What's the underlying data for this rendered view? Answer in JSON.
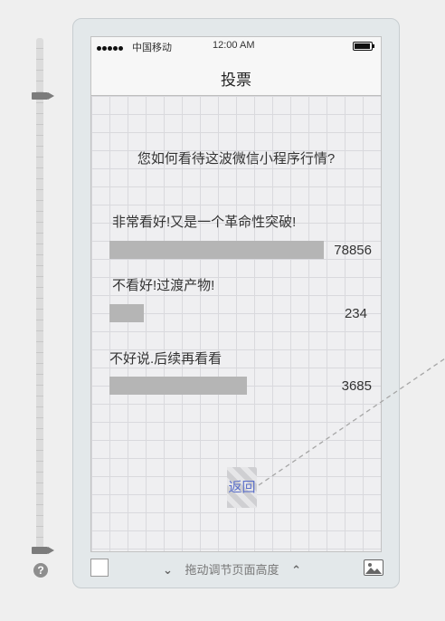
{
  "status_bar": {
    "carrier": "中国移动",
    "time": "12:00 AM"
  },
  "nav": {
    "title": "投票"
  },
  "poll": {
    "question": "您如何看待这波微信小程序行情?",
    "options": [
      {
        "label": "非常看好!又是一个革命性突破!",
        "count": "78856",
        "fill_percent": 100
      },
      {
        "label": "不看好!过渡产物!",
        "count": "234",
        "fill_percent": 16
      },
      {
        "label": "不好说.后续再看看",
        "count": "3685",
        "fill_percent": 64
      }
    ],
    "back_label": "返回"
  },
  "footer": {
    "drag_hint": "拖动调节页面高度"
  },
  "colors": {
    "bar": "#b5b5b5",
    "link": "#5b6fc9"
  },
  "icons": [
    "help-icon",
    "image-icon",
    "chevron-down-icon",
    "chevron-up-icon",
    "battery-icon",
    "signal-icon"
  ]
}
